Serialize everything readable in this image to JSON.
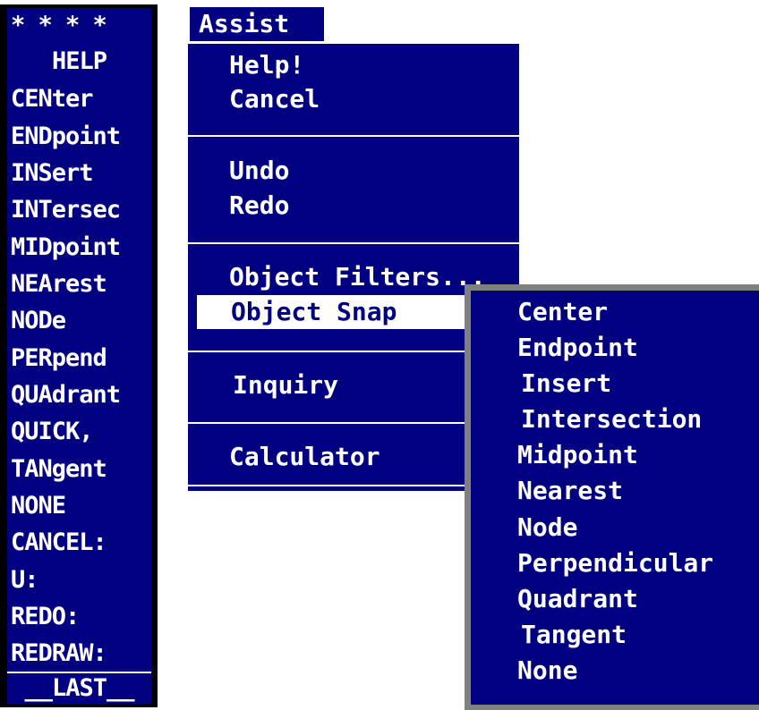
{
  "screen_menu": {
    "header": "* * * *",
    "items": [
      "HELP",
      "CENter",
      "ENDpoint",
      "INSert",
      "INTersec",
      "MIDpoint",
      "NEArest",
      "NODe",
      "PERpend",
      "QUAdrant",
      "QUICK,",
      "TANgent",
      "NONE",
      "CANCEL:",
      "U:",
      "REDO:",
      "REDRAW:"
    ],
    "last": "__LAST__"
  },
  "assist": {
    "title": "Assist",
    "items": [
      "Help!",
      "Cancel",
      "Undo",
      "Redo",
      "Object Filters...",
      "Object Snap",
      "Inquiry",
      "Calculator"
    ],
    "highlighted": "Object Snap"
  },
  "object_snap": {
    "items": [
      "Center",
      "Endpoint",
      "Insert",
      "Intersection",
      "Midpoint",
      "Nearest",
      "Node",
      "Perpendicular",
      "Quadrant",
      "Tangent",
      "None"
    ]
  },
  "colors": {
    "menu_bg": "#000080",
    "text": "#ffffff",
    "highlight_bg": "#ffffff",
    "shadow": "#808080"
  }
}
